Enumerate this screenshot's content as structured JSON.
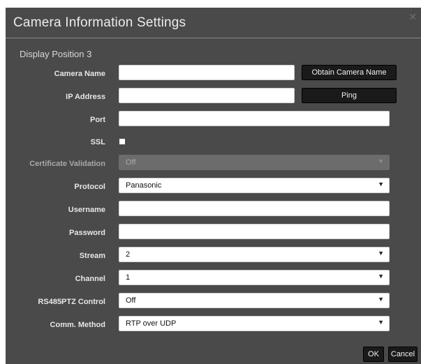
{
  "dialog": {
    "title": "Camera Information Settings",
    "close_icon": "close-icon",
    "section_title": "Display Position 3"
  },
  "fields": {
    "camera_name": {
      "label": "Camera Name",
      "value": ""
    },
    "ip_address": {
      "label": "IP Address",
      "value": ""
    },
    "port": {
      "label": "Port",
      "value": ""
    },
    "ssl": {
      "label": "SSL",
      "checked": false
    },
    "certificate_validation": {
      "label": "Certificate Validation",
      "value": "Off",
      "disabled": true
    },
    "protocol": {
      "label": "Protocol",
      "value": "Panasonic"
    },
    "username": {
      "label": "Username",
      "value": ""
    },
    "password": {
      "label": "Password",
      "value": ""
    },
    "stream": {
      "label": "Stream",
      "value": "2"
    },
    "channel": {
      "label": "Channel",
      "value": "1"
    },
    "rs485ptz_control": {
      "label": "RS485PTZ Control",
      "value": "Off"
    },
    "comm_method": {
      "label": "Comm. Method",
      "value": "RTP over UDP"
    }
  },
  "buttons": {
    "obtain_camera_name": "Obtain Camera Name",
    "ping": "Ping",
    "ok": "OK",
    "cancel": "Cancel"
  },
  "colors": {
    "dialog_bg": "#4a4a4a",
    "dark_button": "#1a1a1a",
    "disabled_field": "#6c6c6c"
  }
}
